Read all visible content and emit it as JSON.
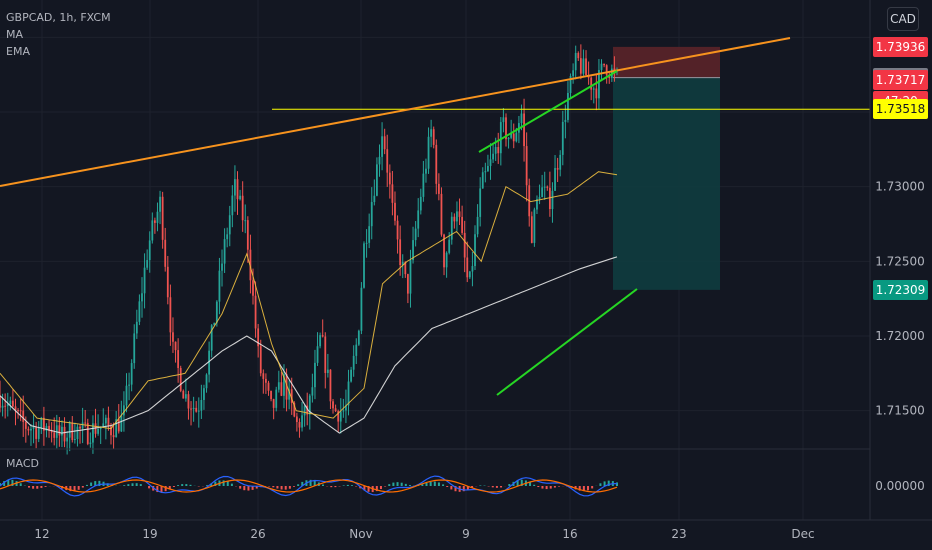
{
  "legend": {
    "symbol": "GBPCAD, 1h, FXCM",
    "line2": "MA",
    "line3": "EMA"
  },
  "currency_button": "CAD",
  "macd_label": "MACD",
  "price_axis": {
    "ticks": [
      {
        "label": "1.73000",
        "value": 1.73
      },
      {
        "label": "1.72500",
        "value": 1.725
      },
      {
        "label": "1.72000",
        "value": 1.72
      },
      {
        "label": "1.71500",
        "value": 1.715
      }
    ],
    "macd_tick": "0.00000"
  },
  "time_axis": [
    "12",
    "19",
    "26",
    "Nov",
    "9",
    "16",
    "23",
    "Dec"
  ],
  "price_tags": [
    {
      "label": "1.73936",
      "value": 1.73936,
      "bg": "#f23645",
      "fg": "#ffffff"
    },
    {
      "label": "1.73730",
      "value": 1.7373,
      "bg": "#787b86",
      "fg": "#ffffff"
    },
    {
      "label": "1.73717",
      "value": 1.73717,
      "bg": "#f23645",
      "fg": "#ffffff"
    },
    {
      "label": "47:20",
      "value": 1.73571,
      "bg": "#f23645",
      "fg": "#ffffff"
    },
    {
      "label": "1.73518",
      "value": 1.73518,
      "bg": "#ffff00",
      "fg": "#131722"
    },
    {
      "label": "1.72309",
      "value": 1.72309,
      "bg": "#089981",
      "fg": "#ffffff"
    }
  ],
  "colors": {
    "background": "#131722",
    "grid": "#1e222d",
    "up": "#26a69a",
    "down": "#ef5350",
    "trendline": "#f7931e",
    "channel": "#26d624",
    "level": "#ffff00",
    "ma": "#e6e6e6",
    "ema": "#f0c040",
    "stop_zone": "#5b2329",
    "target_zone": "#0f3c3f"
  },
  "chart_data": {
    "type": "candlestick",
    "symbol": "GBPCAD",
    "interval": "1h",
    "exchange": "FXCM",
    "currency": "CAD",
    "indicators": [
      "MA",
      "EMA",
      "MACD"
    ],
    "x_labels": [
      "12",
      "19",
      "26",
      "Nov",
      "9",
      "16",
      "23",
      "Dec"
    ],
    "ylim": [
      1.7125,
      1.7425
    ],
    "y_ticks": [
      1.715,
      1.72,
      1.725,
      1.73
    ],
    "price_path": [
      {
        "x": 0,
        "y": 1.716
      },
      {
        "x": 0.02,
        "y": 1.715
      },
      {
        "x": 0.04,
        "y": 1.714
      },
      {
        "x": 0.06,
        "y": 1.7138
      },
      {
        "x": 0.08,
        "y": 1.714
      },
      {
        "x": 0.09,
        "y": 1.7135
      },
      {
        "x": 0.1,
        "y": 1.7132
      },
      {
        "x": 0.12,
        "y": 1.7138
      },
      {
        "x": 0.14,
        "y": 1.7135
      },
      {
        "x": 0.16,
        "y": 1.714
      },
      {
        "x": 0.18,
        "y": 1.7138
      },
      {
        "x": 0.2,
        "y": 1.7145
      },
      {
        "x": 0.24,
        "y": 1.726
      },
      {
        "x": 0.26,
        "y": 1.729
      },
      {
        "x": 0.28,
        "y": 1.719
      },
      {
        "x": 0.3,
        "y": 1.716
      },
      {
        "x": 0.32,
        "y": 1.715
      },
      {
        "x": 0.34,
        "y": 1.719
      },
      {
        "x": 0.36,
        "y": 1.725
      },
      {
        "x": 0.38,
        "y": 1.73
      },
      {
        "x": 0.4,
        "y": 1.727
      },
      {
        "x": 0.42,
        "y": 1.718
      },
      {
        "x": 0.44,
        "y": 1.715
      },
      {
        "x": 0.46,
        "y": 1.717
      },
      {
        "x": 0.48,
        "y": 1.714
      },
      {
        "x": 0.5,
        "y": 1.715
      },
      {
        "x": 0.52,
        "y": 1.72
      },
      {
        "x": 0.54,
        "y": 1.715
      },
      {
        "x": 0.56,
        "y": 1.715
      },
      {
        "x": 0.58,
        "y": 1.72
      },
      {
        "x": 0.59,
        "y": 1.726
      },
      {
        "x": 0.61,
        "y": 1.731
      },
      {
        "x": 0.62,
        "y": 1.734
      },
      {
        "x": 0.64,
        "y": 1.727
      },
      {
        "x": 0.66,
        "y": 1.723
      },
      {
        "x": 0.68,
        "y": 1.729
      },
      {
        "x": 0.7,
        "y": 1.734
      },
      {
        "x": 0.72,
        "y": 1.725
      },
      {
        "x": 0.74,
        "y": 1.729
      },
      {
        "x": 0.76,
        "y": 1.723
      },
      {
        "x": 0.78,
        "y": 1.73
      },
      {
        "x": 0.8,
        "y": 1.732
      },
      {
        "x": 0.815,
        "y": 1.734
      },
      {
        "x": 0.83,
        "y": 1.733
      },
      {
        "x": 0.845,
        "y": 1.735
      },
      {
        "x": 0.86,
        "y": 1.7265
      },
      {
        "x": 0.875,
        "y": 1.73
      },
      {
        "x": 0.89,
        "y": 1.729
      },
      {
        "x": 0.905,
        "y": 1.732
      },
      {
        "x": 0.92,
        "y": 1.736
      },
      {
        "x": 0.935,
        "y": 1.7385
      },
      {
        "x": 0.95,
        "y": 1.7375
      },
      {
        "x": 0.965,
        "y": 1.7365
      },
      {
        "x": 0.98,
        "y": 1.7383
      },
      {
        "x": 1.0,
        "y": 1.7372
      }
    ],
    "ma_path": [
      {
        "x": 0,
        "y": 1.716
      },
      {
        "x": 0.05,
        "y": 1.714
      },
      {
        "x": 0.1,
        "y": 1.7135
      },
      {
        "x": 0.18,
        "y": 1.714
      },
      {
        "x": 0.24,
        "y": 1.715
      },
      {
        "x": 0.3,
        "y": 1.717
      },
      {
        "x": 0.36,
        "y": 1.719
      },
      {
        "x": 0.4,
        "y": 1.72
      },
      {
        "x": 0.44,
        "y": 1.719
      },
      {
        "x": 0.5,
        "y": 1.715
      },
      {
        "x": 0.55,
        "y": 1.7135
      },
      {
        "x": 0.59,
        "y": 1.7145
      },
      {
        "x": 0.64,
        "y": 1.718
      },
      {
        "x": 0.7,
        "y": 1.7205
      },
      {
        "x": 0.76,
        "y": 1.7215
      },
      {
        "x": 0.82,
        "y": 1.7225
      },
      {
        "x": 0.88,
        "y": 1.7235
      },
      {
        "x": 0.94,
        "y": 1.7245
      },
      {
        "x": 1.0,
        "y": 1.7253
      }
    ],
    "ema_path": [
      {
        "x": 0,
        "y": 1.7175
      },
      {
        "x": 0.06,
        "y": 1.7145
      },
      {
        "x": 0.18,
        "y": 1.7138
      },
      {
        "x": 0.24,
        "y": 1.717
      },
      {
        "x": 0.3,
        "y": 1.7175
      },
      {
        "x": 0.36,
        "y": 1.7215
      },
      {
        "x": 0.4,
        "y": 1.7255
      },
      {
        "x": 0.44,
        "y": 1.7195
      },
      {
        "x": 0.48,
        "y": 1.715
      },
      {
        "x": 0.54,
        "y": 1.7145
      },
      {
        "x": 0.59,
        "y": 1.7165
      },
      {
        "x": 0.62,
        "y": 1.7235
      },
      {
        "x": 0.66,
        "y": 1.725
      },
      {
        "x": 0.7,
        "y": 1.726
      },
      {
        "x": 0.74,
        "y": 1.727
      },
      {
        "x": 0.78,
        "y": 1.725
      },
      {
        "x": 0.82,
        "y": 1.73
      },
      {
        "x": 0.86,
        "y": 1.729
      },
      {
        "x": 0.92,
        "y": 1.7295
      },
      {
        "x": 0.97,
        "y": 1.731
      },
      {
        "x": 1.0,
        "y": 1.7308
      }
    ],
    "resistance_level": 1.73518,
    "position": {
      "entry": 1.7373,
      "stop": 1.73936,
      "target": 1.72309
    },
    "countdown": "47:20"
  }
}
